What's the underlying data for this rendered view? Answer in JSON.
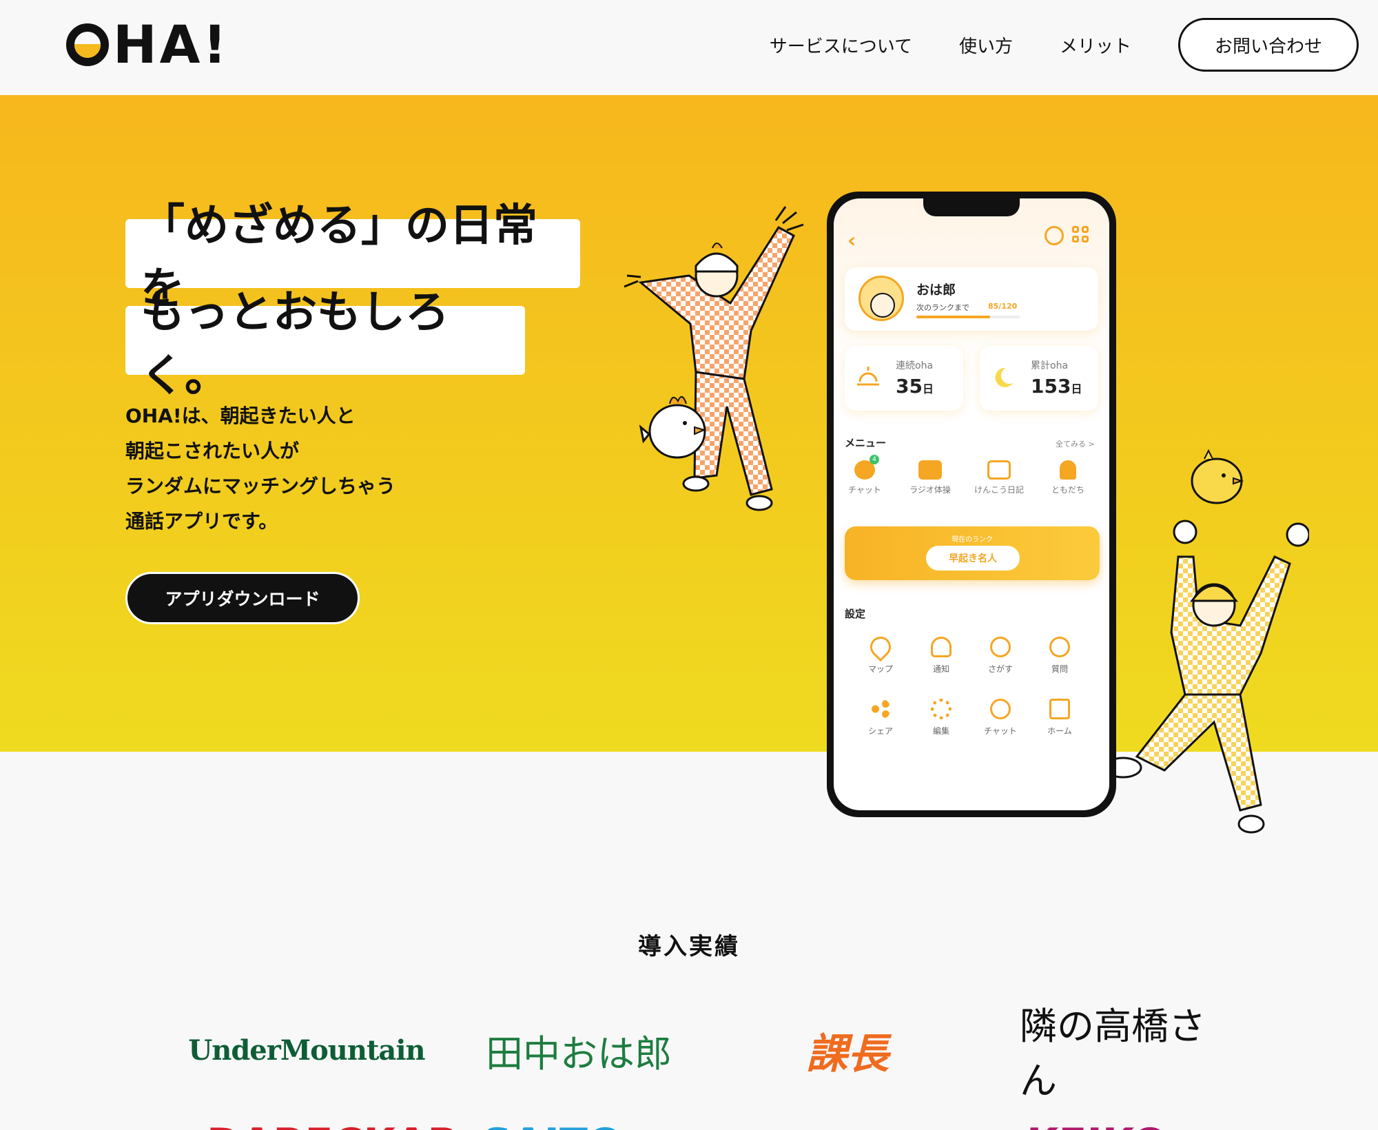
{
  "header": {
    "logo_text": "HA!",
    "nav": [
      "サービスについて",
      "使い方",
      "メリット"
    ],
    "contact_label": "お問い合わせ"
  },
  "hero": {
    "headline_1": "「めざめる」の日常を",
    "headline_2": "もっとおもしろく。",
    "description": [
      "OHA!は、朝起きたい人と",
      "朝起こされたい人が",
      "ランダムにマッチングしちゃう",
      "通話アプリです。"
    ],
    "download_label": "アプリダウンロード"
  },
  "phone": {
    "profile_name": "おは郎",
    "next_rank_label": "次のランクまで",
    "next_rank_value": "85/120",
    "next_rank_progress": 0.71,
    "stat_streak_label": "連続oha",
    "stat_streak_value": "35",
    "stat_total_label": "累計oha",
    "stat_total_value": "153",
    "day_unit": "日",
    "menu_title": "メニュー",
    "menu_more": "全てみる >",
    "menu": [
      "チャット",
      "ラジオ体操",
      "けんこう日記",
      "ともだち"
    ],
    "chat_badge": "4",
    "current_rank_label": "現在のランク",
    "current_rank": "早起き名人",
    "settings_title": "設定",
    "settings_row1": [
      "マップ",
      "通知",
      "さがす",
      "質問"
    ],
    "settings_row2": [
      "シェア",
      "編集",
      "チャット",
      "ホーム"
    ]
  },
  "clients": {
    "title": "導入実績",
    "logos": [
      "UnderMountain",
      "田中おは郎",
      "課長",
      "隣の高橋さん"
    ],
    "logos_partial": [
      "DARECKAR",
      "SAITO",
      "—",
      "KEIKO"
    ]
  },
  "colors": {
    "brand_yellow": "#f7b71d",
    "accent_orange": "#f5a623",
    "text_dark": "#111111"
  }
}
